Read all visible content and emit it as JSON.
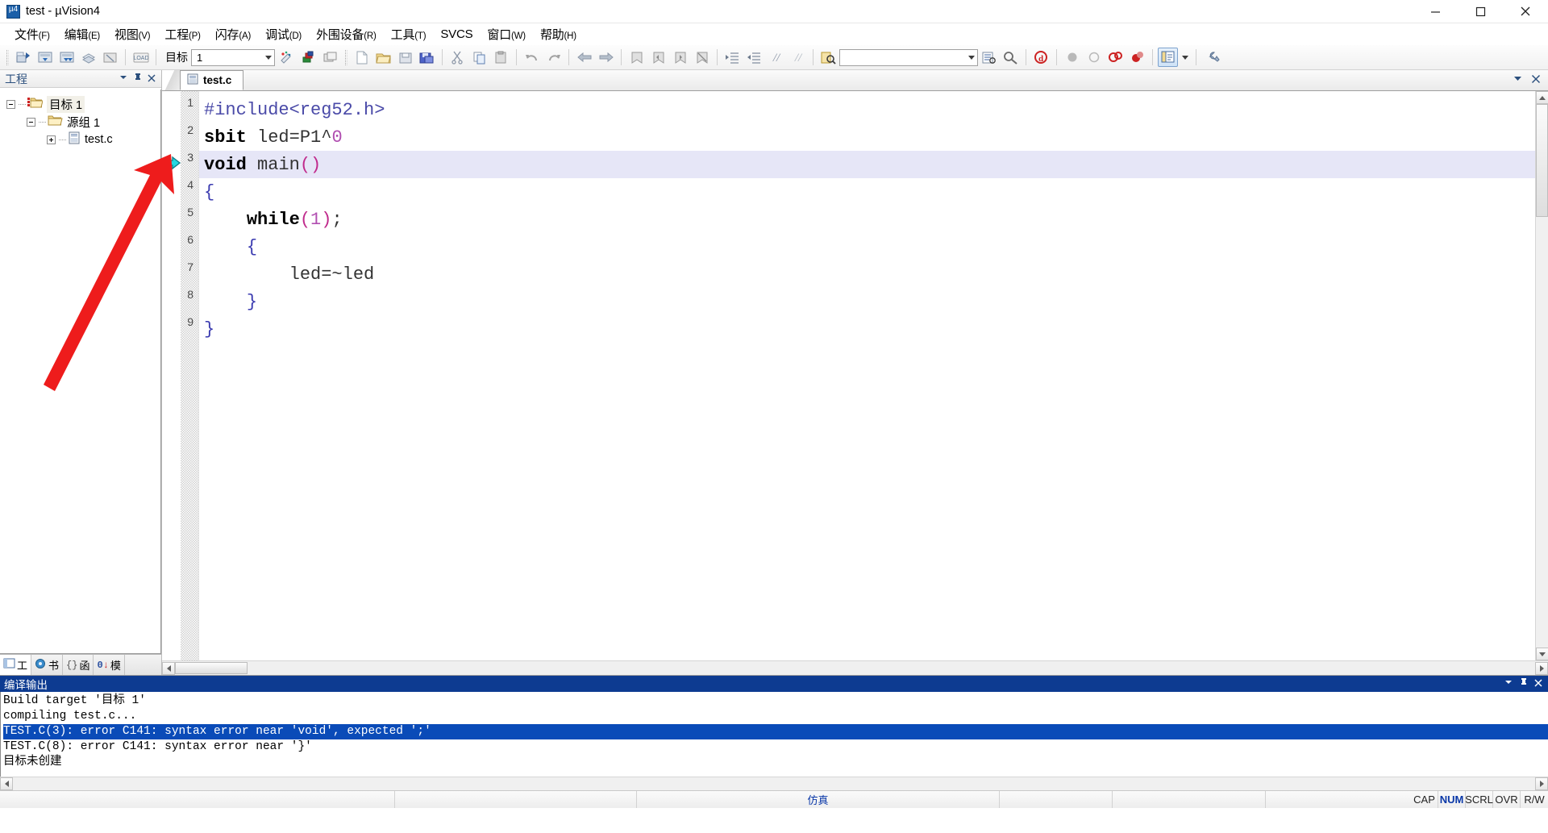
{
  "window": {
    "title": "test  - µVision4",
    "app_icon": "uvision-logo-icon",
    "minimize": "minimize-icon",
    "maximize": "maximize-icon",
    "close": "close-icon"
  },
  "menubar": {
    "items": [
      {
        "label": "文件",
        "mnemonic": "(F)"
      },
      {
        "label": "编辑",
        "mnemonic": "(E)"
      },
      {
        "label": "视图",
        "mnemonic": "(V)"
      },
      {
        "label": "工程",
        "mnemonic": "(P)"
      },
      {
        "label": "闪存",
        "mnemonic": "(A)"
      },
      {
        "label": "调试",
        "mnemonic": "(D)"
      },
      {
        "label": "外围设备",
        "mnemonic": "(R)"
      },
      {
        "label": "工具",
        "mnemonic": "(T)"
      },
      {
        "label": "SVCS",
        "mnemonic": ""
      },
      {
        "label": "窗口",
        "mnemonic": "(W)"
      },
      {
        "label": "帮助",
        "mnemonic": "(H)"
      }
    ]
  },
  "toolbar": {
    "target_label": "目标",
    "target_value": "1",
    "search_value": "",
    "search_placeholder": "",
    "buttons": [
      "build-target-icon",
      "rebuild-all-icon",
      "batch-build-icon",
      "translate-file-icon",
      "stop-build-icon",
      "load-flash-icon",
      "target-options-icon",
      "manage-components-icon",
      "multi-project-icon",
      "new-file-icon",
      "open-file-icon",
      "save-file-icon",
      "save-all-icon",
      "cut-icon",
      "copy-icon",
      "paste-icon",
      "undo-icon",
      "redo-icon",
      "back-icon",
      "forward-icon",
      "bookmark-toggle-icon",
      "bookmark-prev-icon",
      "bookmark-next-icon",
      "bookmark-clear-icon",
      "indent-icon",
      "outdent-icon",
      "comment-icon",
      "uncomment-icon",
      "find-in-files-icon",
      "configuration-wizard-icon",
      "find-icon",
      "start-debug-icon",
      "insert-breakpoint-icon",
      "disable-breakpoint-icon",
      "kill-all-breakpoints-icon",
      "disable-all-breakpoints-icon",
      "project-window-icon",
      "options-wrench-icon"
    ]
  },
  "project_pane": {
    "title": "工程",
    "collapse_icon": "chevron-down-icon",
    "pin_icon": "pin-icon",
    "close_icon": "close-icon",
    "tree": [
      {
        "label": "目标 1",
        "level": 1,
        "expander": "minus",
        "icon": "target-folder-icon",
        "selected": true
      },
      {
        "label": "源组 1",
        "level": 2,
        "expander": "minus",
        "icon": "group-folder-icon",
        "selected": false
      },
      {
        "label": "test.c",
        "level": 3,
        "expander": "plus",
        "icon": "c-source-file-icon",
        "selected": false
      }
    ],
    "tabs": [
      {
        "label": "工",
        "icon": "project-tab-icon",
        "selected": true
      },
      {
        "label": "书",
        "icon": "books-tab-icon",
        "selected": false
      },
      {
        "label": "函",
        "icon": "functions-tab-icon",
        "selected": false
      },
      {
        "label": "模",
        "icon": "templates-tab-icon",
        "selected": false
      }
    ]
  },
  "editor": {
    "tabs": [
      {
        "label": "test.c",
        "icon": "c-source-file-icon",
        "active": true
      }
    ],
    "collapse_icon": "chevron-down-icon",
    "close_icon": "close-icon",
    "current_line": 3,
    "execution_marker": "execution-arrow-icon",
    "lines": [
      {
        "num": 1,
        "tokens": [
          {
            "t": "#include<reg52.h>",
            "c": "pp"
          }
        ]
      },
      {
        "num": 2,
        "tokens": [
          {
            "t": "sbit",
            "c": "kw"
          },
          {
            "t": " led=P1^",
            "c": "plain"
          },
          {
            "t": "0",
            "c": "num"
          }
        ]
      },
      {
        "num": 3,
        "tokens": [
          {
            "t": "void",
            "c": "kw"
          },
          {
            "t": " main",
            "c": "plain"
          },
          {
            "t": "()",
            "c": "paren"
          }
        ]
      },
      {
        "num": 4,
        "tokens": [
          {
            "t": "{",
            "c": "brace"
          }
        ]
      },
      {
        "num": 5,
        "tokens": [
          {
            "t": "    ",
            "c": "plain"
          },
          {
            "t": "while",
            "c": "kw"
          },
          {
            "t": "(",
            "c": "paren"
          },
          {
            "t": "1",
            "c": "num"
          },
          {
            "t": ")",
            "c": "paren"
          },
          {
            "t": ";",
            "c": "plain"
          }
        ]
      },
      {
        "num": 6,
        "tokens": [
          {
            "t": "    ",
            "c": "plain"
          },
          {
            "t": "{",
            "c": "brace"
          }
        ]
      },
      {
        "num": 7,
        "tokens": [
          {
            "t": "        led=~led",
            "c": "plain"
          }
        ]
      },
      {
        "num": 8,
        "tokens": [
          {
            "t": "    ",
            "c": "plain"
          },
          {
            "t": "}",
            "c": "brace"
          }
        ]
      },
      {
        "num": 9,
        "tokens": [
          {
            "t": "}",
            "c": "brace"
          }
        ]
      }
    ]
  },
  "build_output": {
    "title": "编译输出",
    "collapse_icon": "chevron-down-icon",
    "pin_icon": "pin-icon",
    "close_icon": "close-icon",
    "lines": [
      {
        "text": "Build target '目标 1'",
        "selected": false
      },
      {
        "text": "compiling test.c...",
        "selected": false
      },
      {
        "text": "TEST.C(3): error C141: syntax error near 'void', expected ';'",
        "selected": true
      },
      {
        "text": "TEST.C(8): error C141: syntax error near '}'",
        "selected": false
      },
      {
        "text": "目标未创建",
        "selected": false
      }
    ]
  },
  "statusbar": {
    "simulation_label": "仿真",
    "indicators": [
      "CAP",
      "NUM",
      "SCRL",
      "OVR",
      "R/W"
    ],
    "active_indicator": "NUM"
  },
  "annotation": {
    "arrow": "red-pointer-arrow",
    "color": "#ee1c1c"
  },
  "colors": {
    "accent_blue": "#0d3b91",
    "selection_blue": "#0a4bb8",
    "current_line": "#e6e6f7",
    "panel_title": "#2b4f7d"
  }
}
